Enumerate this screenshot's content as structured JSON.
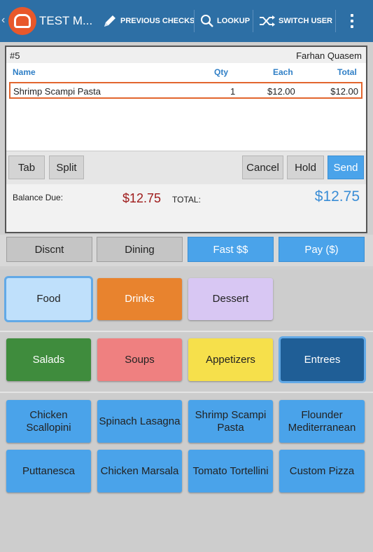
{
  "app": {
    "title": "TEST M...",
    "actions": [
      {
        "label": "PREVIOUS CHECKS",
        "icon": "pencil-icon"
      },
      {
        "label": "LOOKUP",
        "icon": "search-icon"
      },
      {
        "label": "SWITCH USER",
        "icon": "shuffle-icon"
      }
    ]
  },
  "order": {
    "check_number": "#5",
    "server": "Farhan Quasem",
    "columns": {
      "name": "Name",
      "qty": "Qty",
      "each": "Each",
      "total": "Total"
    },
    "items": [
      {
        "name": "Shrimp Scampi Pasta",
        "qty": "1",
        "each": "$12.00",
        "total": "$12.00"
      }
    ],
    "buttons": {
      "tab": "Tab",
      "split": "Split",
      "cancel": "Cancel",
      "hold": "Hold",
      "send": "Send"
    },
    "balance_label": "Balance Due:",
    "balance_value": "$12.75",
    "total_label": "TOTAL:",
    "total_value": "$12.75"
  },
  "functions": [
    "Discnt",
    "Dining",
    "Fast $$",
    "Pay ($)"
  ],
  "menu_groups": [
    "Food",
    "Drinks",
    "Dessert"
  ],
  "categories": [
    "Salads",
    "Soups",
    "Appetizers",
    "Entrees"
  ],
  "items": [
    "Chicken Scallopini",
    "Spinach Lasagna",
    "Shrimp Scampi Pasta",
    "Flounder Mediterranean",
    "Puttanesca",
    "Chicken Marsala",
    "Tomato Tortellini",
    "Custom Pizza"
  ],
  "colors": {
    "actionbar": "#2d6fa5",
    "accent_blue": "#4aa3ea",
    "food": "#bfe0fb",
    "drinks": "#e8832e",
    "dessert": "#d8c7f3",
    "salads": "#3f8c3d",
    "soups": "#ef8080",
    "appetizers": "#f6e04b",
    "entrees": "#1f5e96",
    "balance_red": "#9e1a1a",
    "total_blue": "#3a8dd6"
  }
}
